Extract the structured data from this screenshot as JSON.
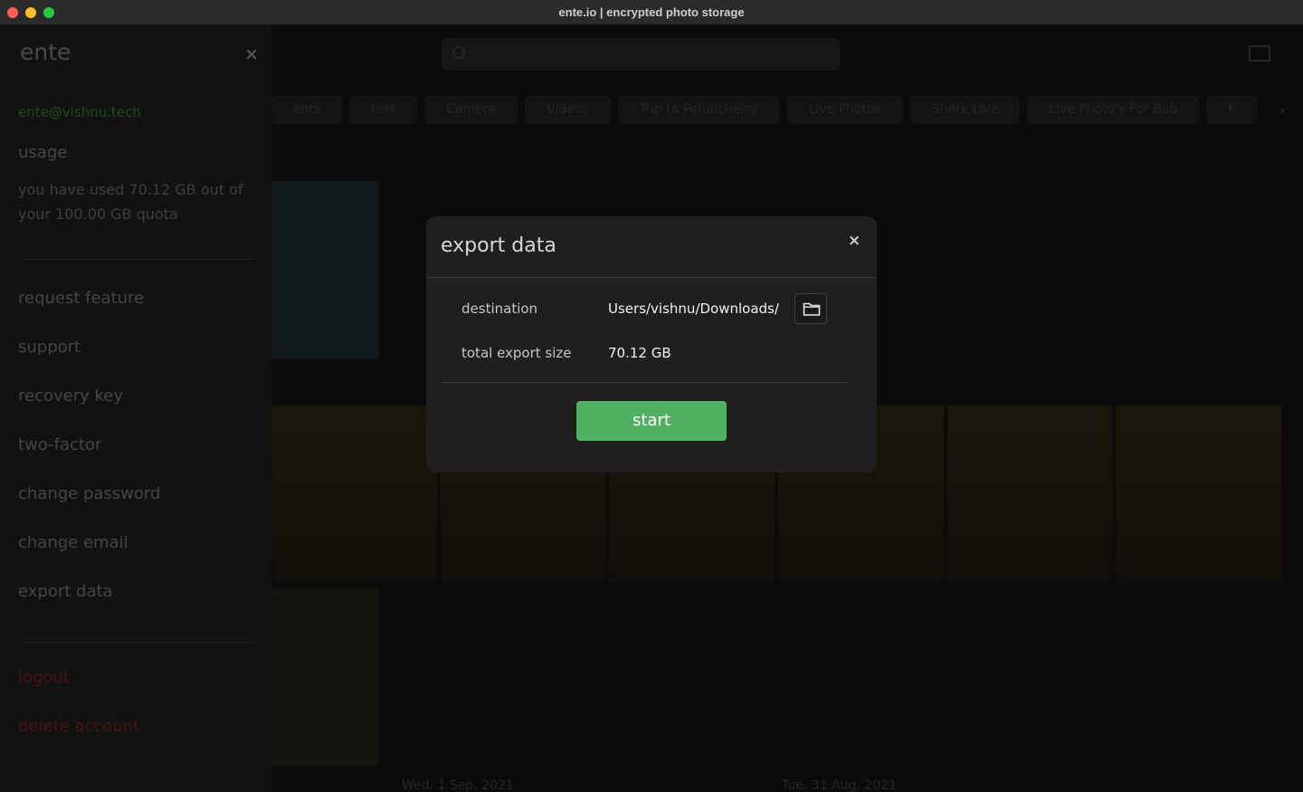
{
  "window": {
    "title": "ente.io | encrypted photo storage"
  },
  "sidebar": {
    "logo": "ente",
    "close_icon": "×",
    "email": "ente@vishnu.tech",
    "usage_heading": "usage",
    "usage_text": "you have used 70.12 GB out of your 100.00 GB quota",
    "items": [
      {
        "label": "request feature"
      },
      {
        "label": "support"
      },
      {
        "label": "recovery key"
      },
      {
        "label": "two-factor"
      },
      {
        "label": "change password"
      },
      {
        "label": "change email"
      },
      {
        "label": "export data"
      }
    ],
    "danger_items": [
      {
        "label": "logout"
      },
      {
        "label": "delete account"
      }
    ]
  },
  "gallery": {
    "chips": [
      "ents",
      "test",
      "Camera",
      "Videos",
      "Trip to Pondicherry",
      "Live Photos",
      "Share Live",
      "Live Photo's For Bob",
      "F"
    ],
    "date_labels": [
      "Wed, 1 Sep, 2021",
      "Tue, 31 Aug, 2021"
    ]
  },
  "export_modal": {
    "title": "export data",
    "close_icon": "×",
    "destination_label": "destination",
    "destination_value": "Users/vishnu/Downloads/",
    "size_label": "total export size",
    "size_value": "70.12 GB",
    "start_label": "start",
    "accent_color": "#51b061"
  },
  "icons": {
    "search": "search-icon",
    "upload": "upload-icon",
    "folder": "folder-icon",
    "chevron": "›"
  }
}
